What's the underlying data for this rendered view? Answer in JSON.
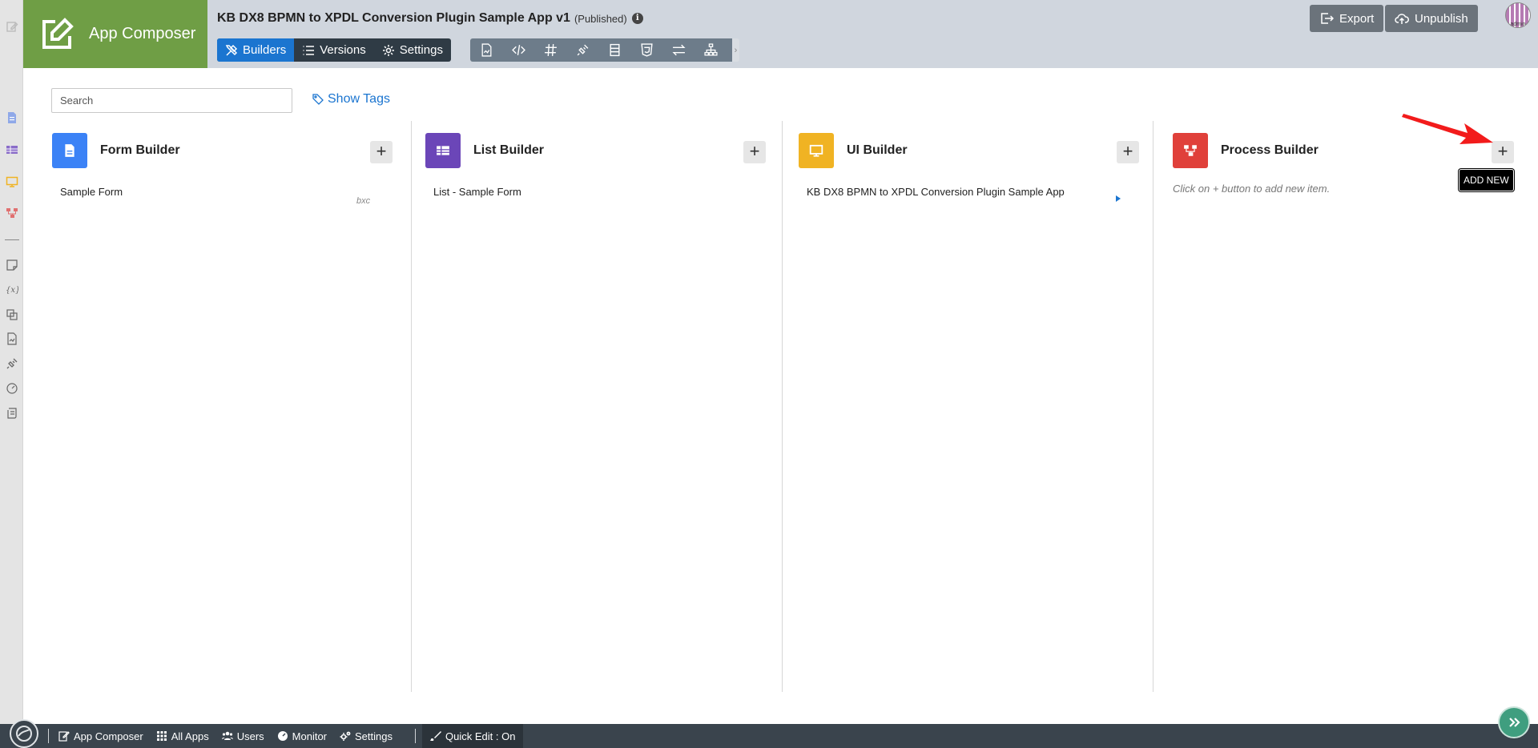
{
  "brand": {
    "label": "App Composer"
  },
  "app": {
    "title": "KB DX8 BPMN to XPDL Conversion Plugin Sample App v1",
    "status": "(Published)"
  },
  "tabs": [
    {
      "label": "Builders",
      "icon": "tools-icon",
      "active": true
    },
    {
      "label": "Versions",
      "icon": "list-icon",
      "active": false
    },
    {
      "label": "Settings",
      "icon": "gear-icon",
      "active": false
    }
  ],
  "tools": [
    "file-chart-icon",
    "code-icon",
    "hash-icon",
    "plug-icon",
    "table-icon",
    "html5-icon",
    "exchange-icon",
    "sitemap-icon"
  ],
  "header_buttons": {
    "export": "Export",
    "unpublish": "Unpublish"
  },
  "avatar": {
    "label": "admin"
  },
  "search": {
    "placeholder": "Search"
  },
  "show_tags": {
    "label": "Show Tags"
  },
  "columns": {
    "form": {
      "title": "Form Builder",
      "color": "#3b82f6",
      "items": [
        {
          "label": "Sample Form",
          "tag": "bxc"
        }
      ]
    },
    "list": {
      "title": "List Builder",
      "color": "#6b46b8",
      "items": [
        {
          "label": "List - Sample Form"
        }
      ]
    },
    "ui": {
      "title": "UI Builder",
      "color": "#f0b323",
      "items": [
        {
          "label": "KB DX8 BPMN to XPDL Conversion Plugin Sample App"
        }
      ]
    },
    "process": {
      "title": "Process Builder",
      "color": "#e0403a",
      "empty_hint": "Click on + button to add new item."
    }
  },
  "tooltip": {
    "label": "ADD NEW"
  },
  "footer": {
    "items": [
      {
        "label": "App Composer",
        "icon": "edit-icon"
      },
      {
        "label": "All Apps",
        "icon": "grid-icon"
      },
      {
        "label": "Users",
        "icon": "users-icon"
      },
      {
        "label": "Monitor",
        "icon": "monitor-icon"
      },
      {
        "label": "Settings",
        "icon": "gears-icon"
      }
    ],
    "quick_edit": "Quick Edit : On"
  }
}
